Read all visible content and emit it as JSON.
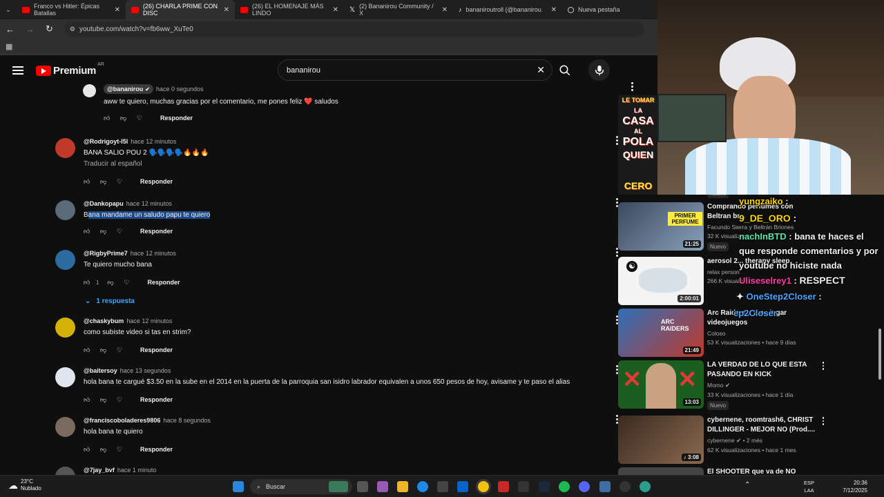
{
  "browser": {
    "tabs": [
      {
        "title": "Franco vs Hitler: Épicas Batallas",
        "icon": "youtube-icon",
        "active": false
      },
      {
        "title": "(26) CHARLA PRIME CON DISC",
        "icon": "youtube-icon",
        "active": true
      },
      {
        "title": "(26) EL HOMENAJE MÁS LINDO",
        "icon": "youtube-icon",
        "active": false
      },
      {
        "title": "(2) Bananirou Community / X",
        "icon": "x-icon",
        "active": false
      },
      {
        "title": "bananiroutroll (@bananirou.xd)",
        "icon": "tiktok-icon",
        "active": false
      },
      {
        "title": "Nueva pestaña",
        "icon": "chrome-icon",
        "active": false
      }
    ],
    "url": "youtube.com/watch?v=fb6ww_XuTe0"
  },
  "header": {
    "brand": "Premium",
    "country": "AR",
    "search_value": "bananirou"
  },
  "comments": [
    {
      "author": "@bananirou",
      "verified_badge": true,
      "time": "hace 0 segundos",
      "text": "aww te quiero, muchas gracias por el comentario, me pones feliz ❤️ saludos",
      "reply_label": "Responder",
      "avatar_color": "#e8e8e8"
    },
    {
      "author": "@Rodrigoyt-l5l",
      "time": "hace 12 minutos",
      "text": "BANA SALIO POU 2 🗣️🗣️🗣️🗣️🔥🔥🔥",
      "translate": "Traducir al español",
      "reply_label": "Responder",
      "avatar_color": "#c0392b"
    },
    {
      "author": "@Dankopapu",
      "time": "hace 12 minutos",
      "text_first": "B",
      "text_highlight": "ana mandame un saludo papu te quiero",
      "reply_label": "Responder",
      "avatar_color": "#5a6a78"
    },
    {
      "author": "@RigbyPrime7",
      "time": "hace 12 minutos",
      "text": "Te quiero mucho bana",
      "likes": "1",
      "reply_label": "Responder",
      "replies_label": "1 respuesta",
      "avatar_color": "#2d6a9f"
    },
    {
      "author": "@chaskybum",
      "time": "hace 12 minutos",
      "text": "como subiste video si tas en strim?",
      "reply_label": "Responder",
      "avatar_color": "#d4b106"
    },
    {
      "author": "@baitersoy",
      "time": "hace 13 segundos",
      "text": "hola bana te cargué $3.50 en la sube en el 2014 en la puerta de la parroquia san isidro labrador equivalen a unos 650 pesos de hoy, avisame y te paso el alias",
      "reply_label": "Responder",
      "avatar_color": "#dfe6f0"
    },
    {
      "author": "@franciscoboladeres9806",
      "time": "hace 8 segundos",
      "text": "hola bana te quiero",
      "reply_label": "Responder",
      "avatar_color": "#7a6a60"
    },
    {
      "author": "@7jay_bvf",
      "time": "hace 1 minuto",
      "avatar_color": "#555"
    }
  ],
  "recommendations": [
    {
      "title": "Comprando perfumes con Beltran br...",
      "channel": "Facundo Sierra y Beltrán Briones",
      "meta": "32 K visualizaciones",
      "badge": "Nuevo",
      "duration": "21:25",
      "thumb_text": "PRIMER PERFUME"
    },
    {
      "title": "aerosol 2... therapy sleep",
      "channel": "relax person",
      "meta": "266 K visualizaciones",
      "badge": "",
      "duration": "2:00:01"
    },
    {
      "title": "Arc Raiders... amo jugar videojuegos",
      "channel": "Coloso",
      "meta": "53 K visualizaciones • hace 9 días",
      "badge": "",
      "duration": "21:49",
      "thumb_text": "ARC RAIDERS"
    },
    {
      "title": "LA VERDAD DE LO QUE ESTA PASANDO EN KICK",
      "channel": "Momo",
      "meta": "33 K visualizaciones • hace 1 día",
      "badge": "Nuevo",
      "duration": "13:03"
    },
    {
      "title": "cybernene, roomtrash6, CHRIST DILLINGER - MEJOR NO (Prod....",
      "channel": "cybernene",
      "channel_extra": "• 2 més",
      "meta": "62 K visualizaciones • hace 1 mes",
      "badge": "",
      "duration": "3:08"
    },
    {
      "title": "El SHOOTER que va de NO",
      "channel": "",
      "meta": "",
      "badge": "",
      "duration": ""
    }
  ],
  "overlay": {
    "banner_lines": [
      "LE TOMAR",
      "LA",
      "CASA",
      "AL",
      "POLA",
      "QUIEN",
      "CERO"
    ],
    "nuevo": "Nuevo"
  },
  "chat": [
    {
      "user": "yungzaiko",
      "sep": ":",
      "msg": "",
      "color": "#ffd700"
    },
    {
      "user": "9_DE_ORO",
      "sep": ":",
      "msg": "",
      "color": "#ffd700"
    },
    {
      "user": "nachInBTD",
      "sep": ":",
      "msg": "bana te haces el que responde comentarios y por youtube no hiciste nada",
      "color": "#5be7a9"
    },
    {
      "user": "Uliseselrey1",
      "sep": ":",
      "msg": "RESPECT",
      "color": "#ff3fa4"
    },
    {
      "user": "OneStep2Closer",
      "sep": ":",
      "msg": "",
      "color": "#4da6ff"
    },
    {
      "user": "ep2Closer",
      "sep": "",
      "msg": "",
      "color": "#4da6ff"
    }
  ],
  "taskbar": {
    "temp": "23°C",
    "weather": "Nublado",
    "search_placeholder": "Buscar",
    "lang1": "ESP",
    "lang2": "LAA",
    "time": "20:36",
    "date": "7/12/2025"
  },
  "colors": {
    "accent_blue": "#3ea6ff",
    "yt_red": "#ff0000",
    "highlight": "#1f4a8a"
  }
}
